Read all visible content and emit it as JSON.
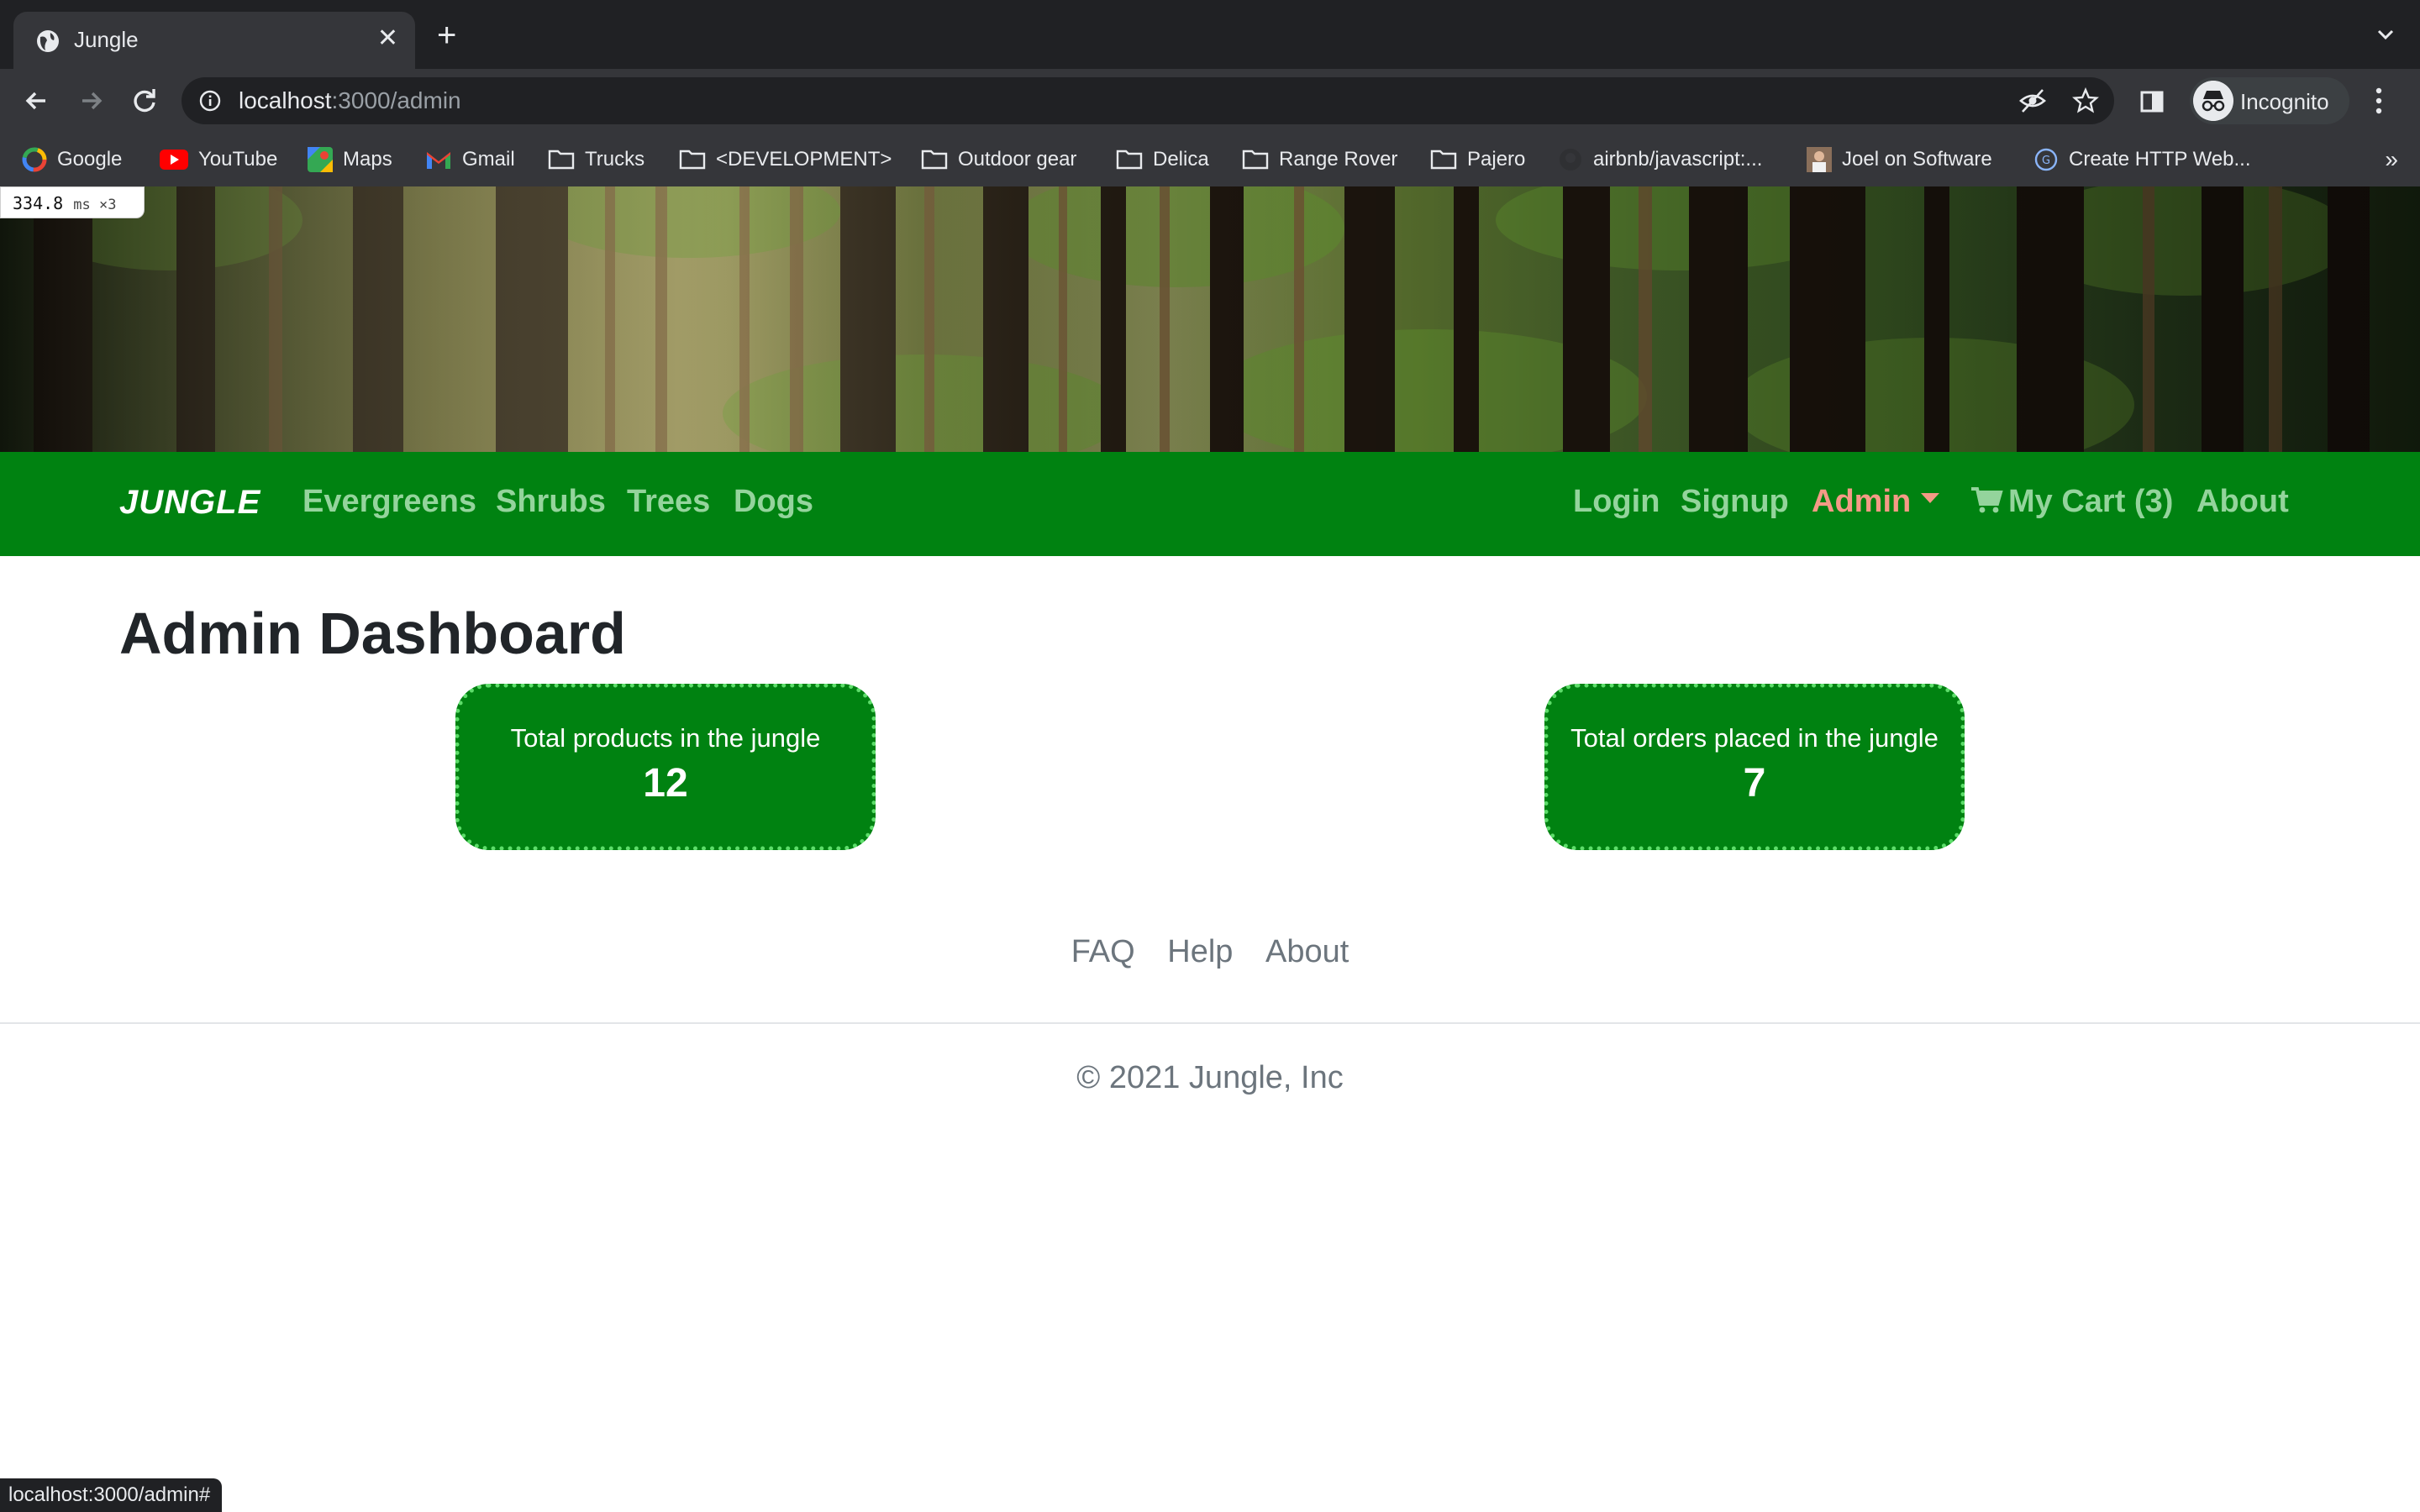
{
  "browser": {
    "tab_title": "Jungle",
    "url_host": "localhost",
    "url_rest": ":3000/admin",
    "profile_label": "Incognito",
    "bookmarks": [
      "Google",
      "YouTube",
      "Maps",
      "Gmail",
      "Trucks",
      "<DEVELOPMENT>",
      "Outdoor gear",
      "Delica",
      "Range Rover",
      "Pajero",
      "airbnb/javascript:...",
      "Joel on Software",
      "Create HTTP Web..."
    ],
    "bookmarks_more": "»",
    "status_url": "localhost:3000/admin#"
  },
  "perf_overlay": {
    "value": "334.8",
    "unit": "ms ×3"
  },
  "nav": {
    "brand": "JUNGLE",
    "left_links": [
      "Evergreens",
      "Shrubs",
      "Trees",
      "Dogs"
    ],
    "login": "Login",
    "signup": "Signup",
    "admin": "Admin",
    "cart": "My Cart (3)",
    "about": "About"
  },
  "page": {
    "title": "Admin Dashboard",
    "cards": [
      {
        "label": "Total products in the jungle",
        "value": "12"
      },
      {
        "label": "Total orders placed in the jungle",
        "value": "7"
      }
    ]
  },
  "footer": {
    "links": [
      "FAQ",
      "Help",
      "About"
    ],
    "copyright": "© 2021 Jungle, Inc"
  },
  "colors": {
    "nav_bg": "#008211",
    "nav_link": "#94d49c",
    "admin_active": "#f59a86",
    "card_border": "#5ddd6a"
  }
}
